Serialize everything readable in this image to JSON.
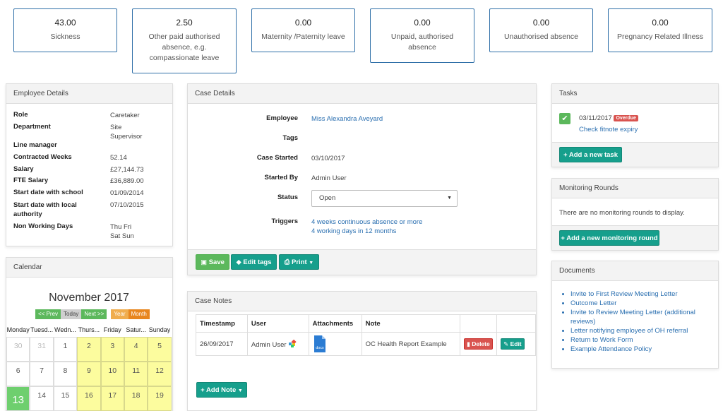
{
  "stats": [
    {
      "value": "43.00",
      "label": "Sickness"
    },
    {
      "value": "2.50",
      "label": "Other paid authorised absence, e.g. compassionate leave"
    },
    {
      "value": "0.00",
      "label": "Maternity /Paternity leave"
    },
    {
      "value": "0.00",
      "label": "Unpaid, authorised absence"
    },
    {
      "value": "0.00",
      "label": "Unauthorised absence"
    },
    {
      "value": "0.00",
      "label": "Pregnancy Related Illness"
    }
  ],
  "employee_details": {
    "title": "Employee Details",
    "rows": [
      {
        "label": "Role",
        "value": "Caretaker"
      },
      {
        "label": "Department",
        "value": "Site Supervisor"
      },
      {
        "label": "Line manager",
        "value": ""
      },
      {
        "label": "Contracted Weeks",
        "value": "52.14"
      },
      {
        "label": "Salary",
        "value": "£27,144.73"
      },
      {
        "label": "FTE Salary",
        "value": "£36,889.00"
      },
      {
        "label": "Start date with school",
        "value": "01/09/2014"
      },
      {
        "label": "Start date with local authority",
        "value": "07/10/2015"
      },
      {
        "label": "Non Working Days",
        "value": "Thu Fri\nSat Sun"
      }
    ]
  },
  "case_details": {
    "title": "Case Details",
    "employee_label": "Employee",
    "employee_value": "Miss Alexandra Aveyard",
    "tags_label": "Tags",
    "case_started_label": "Case Started",
    "case_started_value": "03/10/2017",
    "started_by_label": "Started By",
    "started_by_value": "Admin User",
    "status_label": "Status",
    "status_value": "Open",
    "triggers_label": "Triggers",
    "triggers": [
      "4 weeks continuous absence or more",
      "4 working days in 12 months"
    ],
    "save_label": "Save",
    "edit_tags_label": "Edit tags",
    "print_label": "Print"
  },
  "case_notes": {
    "title": "Case Notes",
    "columns": [
      "Timestamp",
      "User",
      "Attachments",
      "Note",
      "",
      ""
    ],
    "rows": [
      {
        "timestamp": "26/09/2017",
        "user": "Admin User",
        "attachment": "docx",
        "note": "OC Health Report Example",
        "delete_label": "Delete",
        "edit_label": "Edit"
      }
    ],
    "add_note_label": "Add Note"
  },
  "tasks": {
    "title": "Tasks",
    "items": [
      {
        "date": "03/11/2017",
        "badge": "Overdue",
        "text": "Check fitnote expiry"
      }
    ],
    "add_label": "Add a new task"
  },
  "monitoring": {
    "title": "Monitoring Rounds",
    "empty_text": "There are no monitoring rounds to display.",
    "add_label": "Add a new monitoring round"
  },
  "documents": {
    "title": "Documents",
    "items": [
      "Invite to First Review Meeting Letter",
      "Outcome Letter",
      "Invite to Review Meeting Letter (additional reviews)",
      "Letter notifying employee of OH referral",
      "Return to Work Form",
      "Example Attendance Policy"
    ]
  },
  "calendar": {
    "title": "Calendar",
    "month": "November 2017",
    "buttons": {
      "prev": "<< Prev",
      "today": "Today",
      "next": "Next >>",
      "year": "Year",
      "month": "Month"
    },
    "weekdays": [
      "Monday",
      "Tuesd...",
      "Wedn...",
      "Thurs...",
      "Friday",
      "Satur...",
      "Sunday"
    ],
    "weeks": [
      [
        "30",
        "31",
        "1",
        "2",
        "3",
        "4",
        "5"
      ],
      [
        "6",
        "7",
        "8",
        "9",
        "10",
        "11",
        "12"
      ],
      [
        "13",
        "14",
        "15",
        "16",
        "17",
        "18",
        "19"
      ]
    ],
    "colors": {
      "highlight": "#fcfc9e",
      "today": "#6ecf6e",
      "prev": "#5cb85c",
      "year": "#f0ad4e"
    }
  }
}
